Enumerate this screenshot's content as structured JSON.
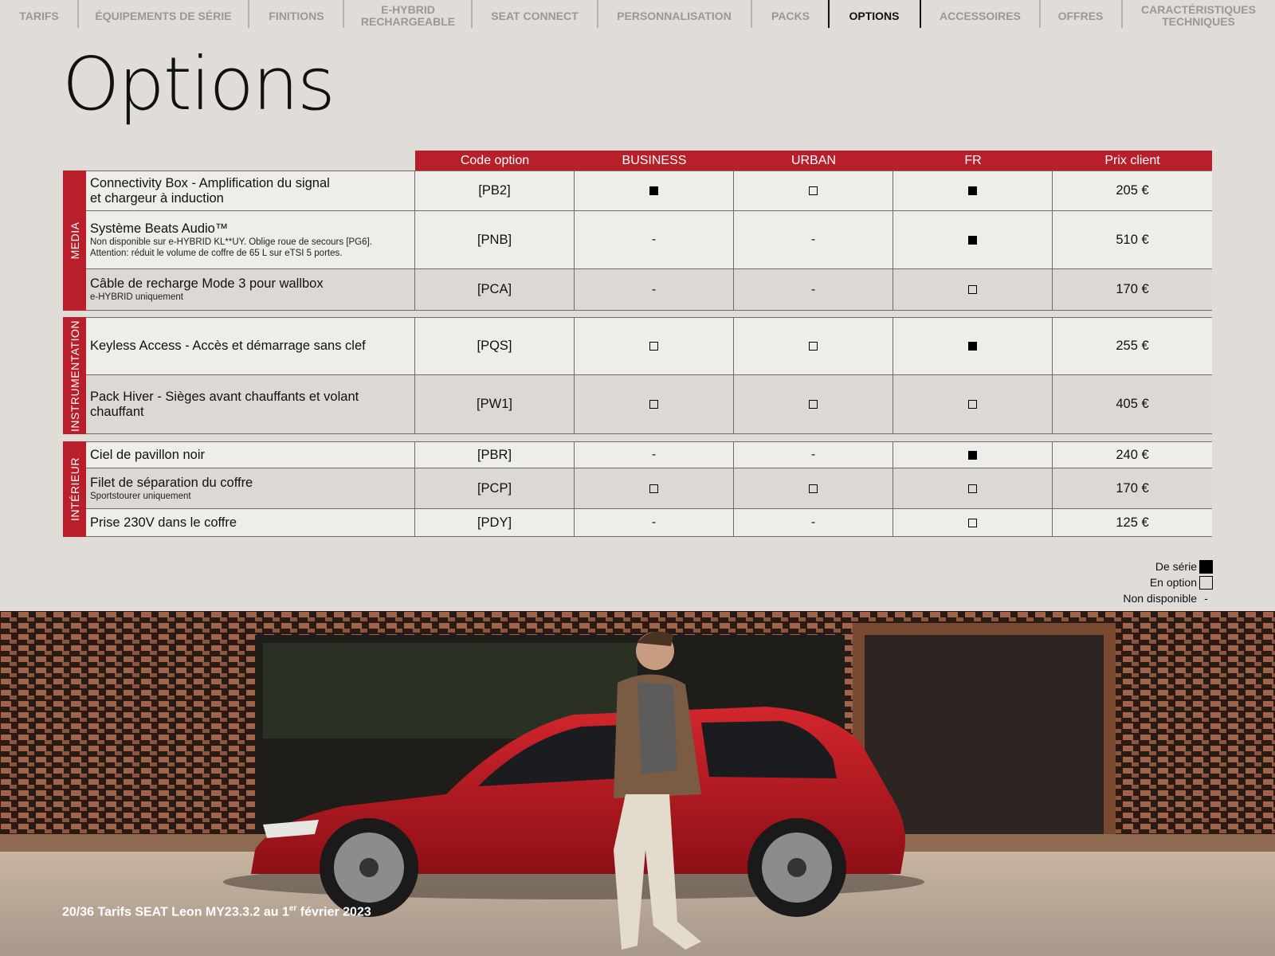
{
  "nav": {
    "items": [
      {
        "label": "TARIFS"
      },
      {
        "label": "ÉQUIPEMENTS DE SÉRIE"
      },
      {
        "label": "FINITIONS"
      },
      {
        "label": "e-HYBRID\nRECHARGEABLE"
      },
      {
        "label": "SEAT CONNECT"
      },
      {
        "label": "PERSONNALISATION"
      },
      {
        "label": "PACKS"
      },
      {
        "label": "OPTIONS",
        "active": true
      },
      {
        "label": "ACCESSOIRES"
      },
      {
        "label": "OFFRES"
      },
      {
        "label": "CARACTÉRISTIQUES\nTECHNIQUES"
      }
    ]
  },
  "page_title": "Options",
  "table": {
    "columns": [
      "Code option",
      "BUSINESS",
      "URBAN",
      "FR",
      "Prix client"
    ],
    "groups": [
      {
        "label": "MEDIA",
        "rows": [
          {
            "name": "Connectivity Box - Amplification du signal\net chargeur à induction",
            "note": "",
            "code": "[PB2]",
            "business": "serie",
            "urban": "option",
            "fr": "serie",
            "price": "205 €"
          },
          {
            "name": "Système Beats Audio™",
            "note": "Non disponible sur e-HYBRID KL**UY. Oblige roue de secours [PG6].\nAttention: réduit le volume de coffre de 65 L sur eTSI 5 portes.",
            "code": "[PNB]",
            "business": "na",
            "urban": "na",
            "fr": "serie",
            "price": "510 €"
          },
          {
            "name": "Câble de recharge Mode 3 pour wallbox",
            "note": "e-HYBRID uniquement",
            "code": "[PCA]",
            "business": "na",
            "urban": "na",
            "fr": "option",
            "price": "170 €"
          }
        ]
      },
      {
        "label": "INSTRUMENTATION",
        "rows": [
          {
            "name": "Keyless Access - Accès et démarrage sans clef",
            "note": "",
            "code": "[PQS]",
            "business": "option",
            "urban": "option",
            "fr": "serie",
            "price": "255 €"
          },
          {
            "name": "Pack Hiver - Sièges avant chauffants et volant chauffant",
            "note": "",
            "code": "[PW1]",
            "business": "option",
            "urban": "option",
            "fr": "option",
            "price": "405 €"
          }
        ]
      },
      {
        "label": "INTÉRIEUR",
        "rows": [
          {
            "name": "Ciel de pavillon noir",
            "note": "",
            "code": "[PBR]",
            "business": "na",
            "urban": "na",
            "fr": "serie",
            "price": "240 €"
          },
          {
            "name": "Filet de séparation du coffre",
            "note": "Sportstourer uniquement",
            "code": "[PCP]",
            "business": "option",
            "urban": "option",
            "fr": "option",
            "price": "170 €"
          },
          {
            "name": "Prise 230V dans le coffre",
            "note": "",
            "code": "[PDY]",
            "business": "na",
            "urban": "na",
            "fr": "option",
            "price": "125 €"
          }
        ]
      }
    ],
    "na_symbol": "-"
  },
  "legend": {
    "serie": "De série",
    "option": "En option",
    "na": "Non disponible",
    "na_symbol": "-"
  },
  "footer": {
    "page": "20/36",
    "text": "Tarifs SEAT Leon MY23.3.2 au 1",
    "sup": "er",
    "text_end": " février 2023"
  },
  "colors": {
    "accent": "#b81f2b",
    "background": "#e0ddd8",
    "car": "#b3141c"
  }
}
